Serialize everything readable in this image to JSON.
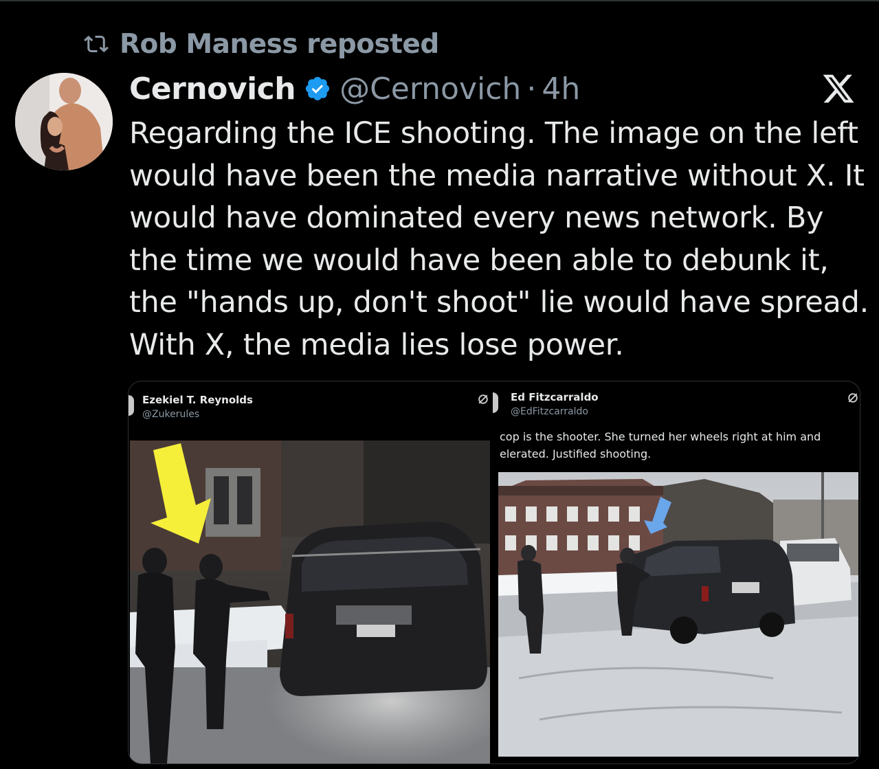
{
  "repost": {
    "text": "Rob Maness reposted"
  },
  "author": {
    "name": "Cernovich",
    "handle": "@Cernovich",
    "separator": "·",
    "time": "4h"
  },
  "tweet": {
    "lines": [
      "Regarding the ICE shooting. The image on the left",
      "would have been the media narrative without X. It",
      "would have dominated every news network. By",
      "the time we would have been able to debunk it,",
      "the \"hands up, don't shoot\" lie would have spread.",
      "With X, the media lies lose power."
    ]
  },
  "embedded_left": {
    "name": "Ezekiel T. Reynolds",
    "handle": "@Zukerules"
  },
  "embedded_right": {
    "name": "Ed Fitzcarraldo",
    "handle": "@EdFitzcarraldo",
    "text_line1": "cop is the shooter. She turned her wheels right at him and",
    "text_line2": "elerated. Justified shooting."
  },
  "colors": {
    "background": "#000000",
    "text": "#e7e9ea",
    "muted": "#8b98a5",
    "verified": "#1d9bf0",
    "arrow_left": "#f5ef3a",
    "arrow_right": "#6aa6ea"
  }
}
